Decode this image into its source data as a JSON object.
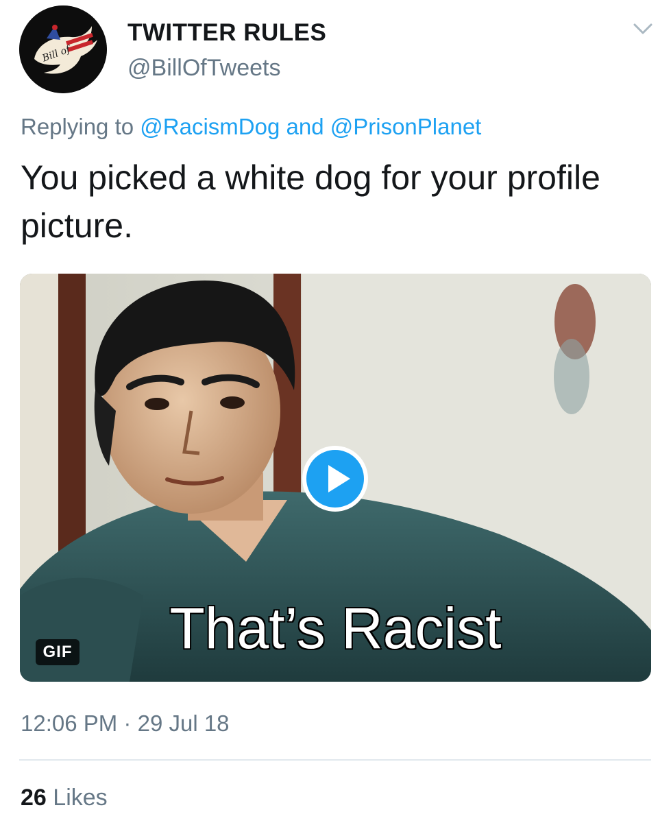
{
  "author": {
    "display_name": "TWITTER RULES",
    "handle": "@BillOfTweets",
    "avatar_logo_text": "Bill of"
  },
  "reply": {
    "prefix": "Replying to",
    "mention_1": "@RacismDog",
    "conjunction": "and",
    "mention_2": "@PrisonPlanet"
  },
  "tweet": {
    "text": "You picked a white dog for your profile picture."
  },
  "media": {
    "caption": "That’s Racist",
    "badge": "GIF",
    "play_icon": "play-circle-icon"
  },
  "meta": {
    "time": "12:06 PM",
    "separator": "·",
    "date": "29 Jul 18"
  },
  "stats": {
    "likes_count": "26",
    "likes_label": "Likes"
  },
  "colors": {
    "accent": "#1da1f2",
    "secondary_text": "#657786",
    "primary_text": "#14171a",
    "divider": "#e1e8ed"
  },
  "icons": {
    "caret": "chevron-down-icon"
  }
}
